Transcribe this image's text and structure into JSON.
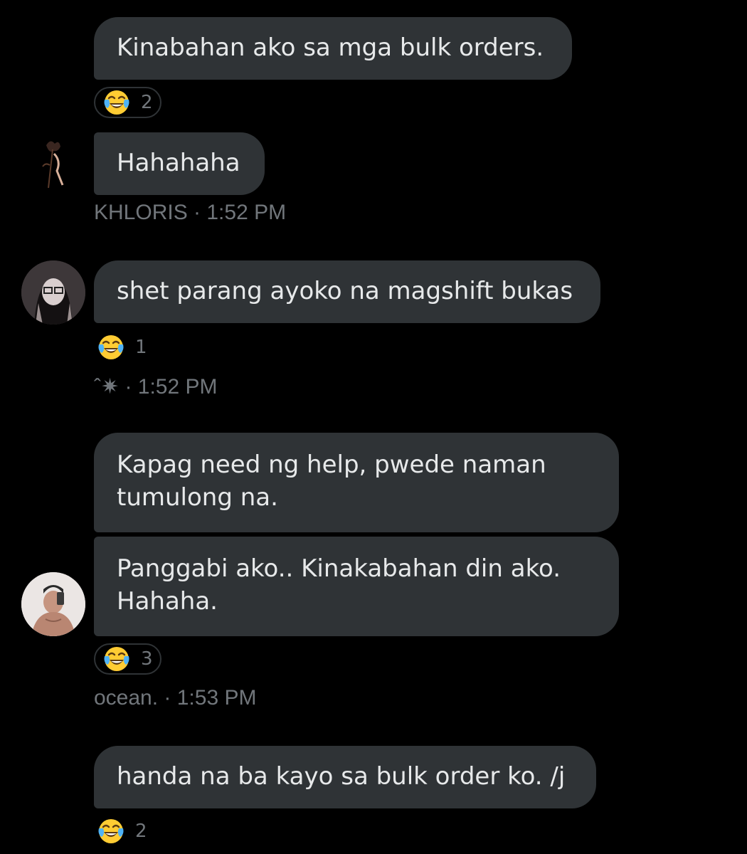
{
  "conversation": {
    "messages": [
      {
        "text": "Kinabahan ako sa mga bulk orders."
      },
      {
        "text": "Hahahaha"
      },
      {
        "text": "shet parang ayoko na magshift bukas"
      },
      {
        "text": "Kapag need ng help, pwede naman tumulong na."
      },
      {
        "text": "Panggabi ako.. Kinakabahan din ako. Hahaha."
      },
      {
        "text": "handa na ba kayo sa bulk order ko. /j"
      }
    ],
    "reactions": [
      {
        "emoji": "face-with-tears-of-joy-icon",
        "count": "2"
      },
      {
        "emoji": "face-with-tears-of-joy-icon",
        "count": "1"
      },
      {
        "emoji": "face-with-tears-of-joy-icon",
        "count": "3"
      },
      {
        "emoji": "face-with-tears-of-joy-icon",
        "count": "2"
      }
    ],
    "meta": [
      {
        "text": "KHLORIS · 1:52 PM"
      },
      {
        "text": "ˆ✷ · 1:52 PM"
      },
      {
        "text": "ocean. · 1:53 PM"
      }
    ]
  },
  "colors": {
    "background": "#000000",
    "bubble": "#2f3336",
    "text": "#e7e9ea",
    "muted": "#71767b"
  }
}
